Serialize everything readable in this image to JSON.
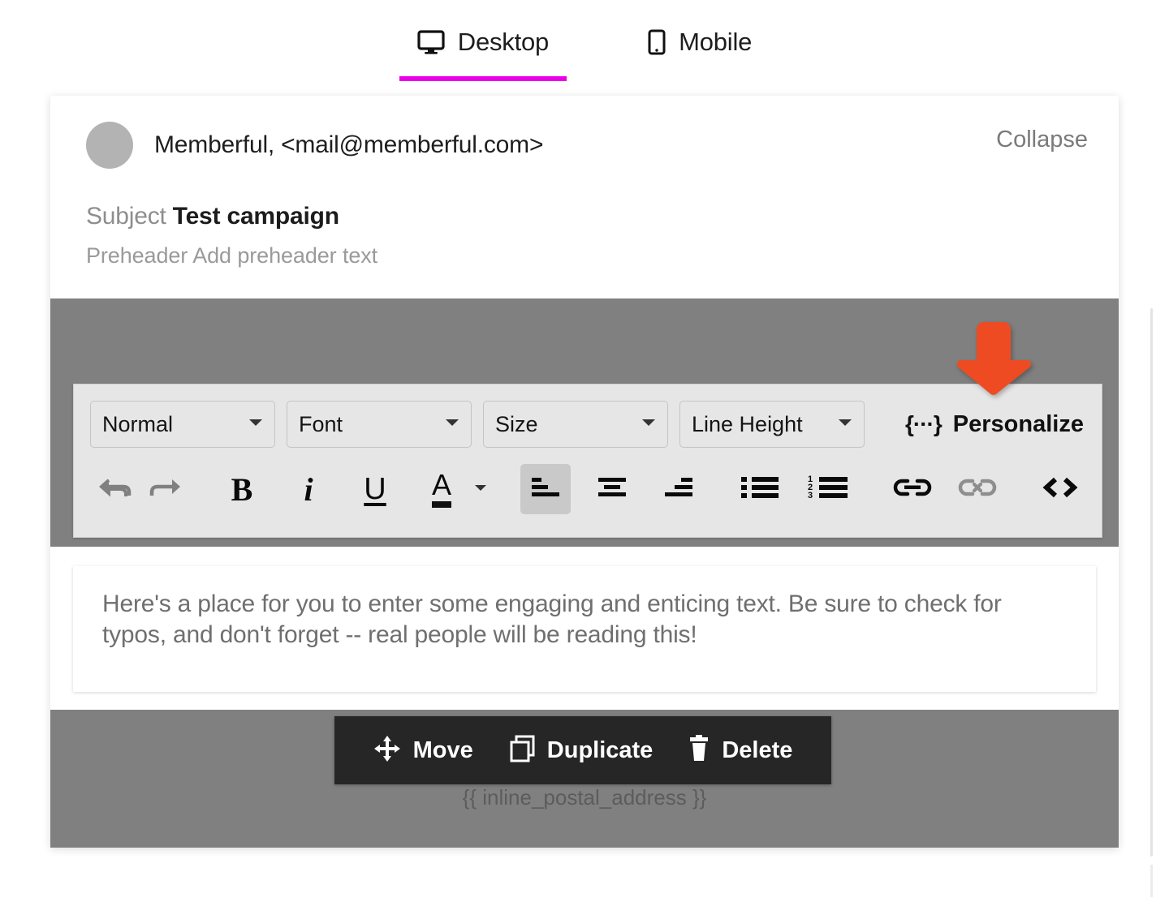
{
  "device_tabs": [
    {
      "id": "desktop",
      "label": "Desktop",
      "icon": "monitor-icon",
      "active": true
    },
    {
      "id": "mobile",
      "label": "Mobile",
      "icon": "phone-icon",
      "active": false
    }
  ],
  "email": {
    "sender_name": "Memberful",
    "sender_separator": ",",
    "sender_email": "<mail@memberful.com>",
    "collapse_label": "Collapse",
    "subject_label": "Subject",
    "subject_value": "Test campaign",
    "preheader_label": "Preheader",
    "preheader_placeholder": "Add preheader text"
  },
  "editor_toolbar": {
    "selects": [
      {
        "name": "block-style",
        "value": "Normal"
      },
      {
        "name": "font-family",
        "value": "Font"
      },
      {
        "name": "font-size",
        "value": "Size"
      },
      {
        "name": "line-height",
        "value": "Line Height"
      }
    ],
    "personalize": {
      "icon": "{···}",
      "label": "Personalize"
    },
    "buttons": [
      {
        "name": "undo",
        "glyph": "undo-arrow-icon",
        "state": "disabled"
      },
      {
        "name": "redo",
        "glyph": "redo-arrow-icon",
        "state": "disabled"
      },
      {
        "name": "bold",
        "glyph": "B",
        "state": "normal"
      },
      {
        "name": "italic",
        "glyph": "i",
        "state": "normal"
      },
      {
        "name": "underline",
        "glyph": "U",
        "state": "normal"
      },
      {
        "name": "text-color",
        "glyph": "A",
        "state": "normal"
      },
      {
        "name": "align-left",
        "glyph": "align-left-icon",
        "state": "active"
      },
      {
        "name": "align-center",
        "glyph": "align-center-icon",
        "state": "normal"
      },
      {
        "name": "align-right",
        "glyph": "align-right-icon",
        "state": "normal"
      },
      {
        "name": "bulleted-list",
        "glyph": "bulleted-list-icon",
        "state": "normal"
      },
      {
        "name": "numbered-list",
        "glyph": "numbered-list-icon",
        "state": "normal"
      },
      {
        "name": "link",
        "glyph": "link-icon",
        "state": "normal"
      },
      {
        "name": "unlink",
        "glyph": "unlink-icon",
        "state": "disabled"
      },
      {
        "name": "source-code",
        "glyph": "code-icon",
        "state": "normal"
      }
    ]
  },
  "body_block": {
    "text": "Here's a place for you to enter some engaging and enticing text. Be sure to check for typos, and don't forget -- real people will be reading this!"
  },
  "block_toolbar": {
    "actions": [
      {
        "name": "move",
        "label": "Move",
        "icon": "move-arrows-icon"
      },
      {
        "name": "duplicate",
        "label": "Duplicate",
        "icon": "copy-icon"
      },
      {
        "name": "delete",
        "label": "Delete",
        "icon": "trash-icon"
      }
    ]
  },
  "footer": {
    "postal_token": "{{ inline_postal_address }}"
  },
  "annotation": {
    "arrow": "down-arrow-annotation",
    "color": "#ee4b22",
    "points_at": "Personalize"
  },
  "colors": {
    "accent_tab_underline": "#ea00e8",
    "overlay_gray": "#808080",
    "toolbar_gray": "#e6e6e6",
    "block_toolbar_dark": "#262626",
    "annotation_orange": "#ee4b22"
  }
}
